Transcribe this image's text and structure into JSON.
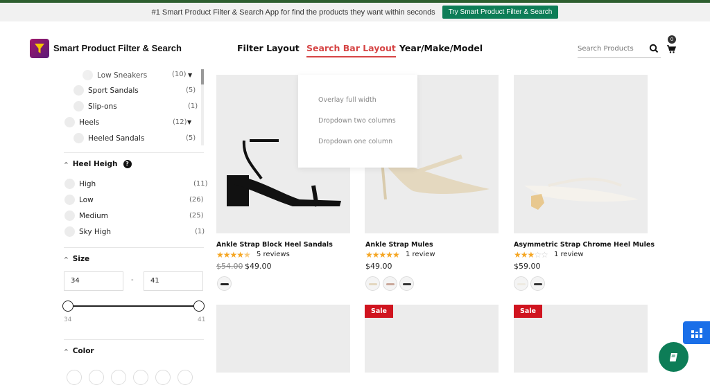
{
  "announcement": {
    "text": "#1 Smart Product Filter & Search App for find the products they want within seconds",
    "button_label": "Try Smart Product Filter & Search"
  },
  "header": {
    "brand": "Smart Product Filter & Search",
    "nav": [
      {
        "label": "Filter Layout",
        "active": false
      },
      {
        "label": "Search Bar Layout",
        "active": true
      },
      {
        "label": "Year/Make/Model",
        "active": false
      }
    ],
    "search_placeholder": "Search Products",
    "cart_count": "0"
  },
  "nav_dropdown": {
    "items": [
      "Overlay full width",
      "Dropdown two columns",
      "Dropdown one column"
    ]
  },
  "sidebar": {
    "category_items": [
      {
        "label": "Low Sneakers",
        "count": "(10)",
        "indent": true,
        "expandable": true
      },
      {
        "label": "Sport Sandals",
        "count": "(5)",
        "indent": true
      },
      {
        "label": "Slip-ons",
        "count": "(1)",
        "indent": true
      },
      {
        "label": "Heels",
        "count": "(12)",
        "indent": false,
        "expandable": true
      },
      {
        "label": "Heeled Sandals",
        "count": "(5)",
        "indent": true
      }
    ],
    "heel_height": {
      "title": "Heel Heigh",
      "items": [
        {
          "label": "High",
          "count": "(11)"
        },
        {
          "label": "Low",
          "count": "(26)"
        },
        {
          "label": "Medium",
          "count": "(25)"
        },
        {
          "label": "Sky High",
          "count": "(1)"
        }
      ]
    },
    "size": {
      "title": "Size",
      "min_value": "34",
      "max_value": "41",
      "dash": "-",
      "range_min_label": "34",
      "range_max_label": "41"
    },
    "color": {
      "title": "Color"
    }
  },
  "products": [
    {
      "title": "Ankle Strap Block Heel Sandals",
      "rating": 4.5,
      "reviews": "5 reviews",
      "old_price": "$54.00",
      "price": "$49.00",
      "swatches": [
        "#222222"
      ]
    },
    {
      "title": "Ankle Strap Mules",
      "rating": 5,
      "reviews": "1 review",
      "old_price": "",
      "price": "$49.00",
      "swatches": [
        "#e3d7bf",
        "#c9a79a",
        "#333333"
      ]
    },
    {
      "title": "Asymmetric Strap Chrome Heel Mules",
      "rating": 3,
      "reviews": "1 review",
      "old_price": "",
      "price": "$59.00",
      "swatches": [
        "#eeeae2",
        "#333333"
      ]
    }
  ],
  "second_row": {
    "sale_badge": "Sale"
  },
  "colors": {
    "accent": "#d64545",
    "sale": "#d0141f",
    "green": "#0d7d57",
    "star": "#f5a623"
  }
}
